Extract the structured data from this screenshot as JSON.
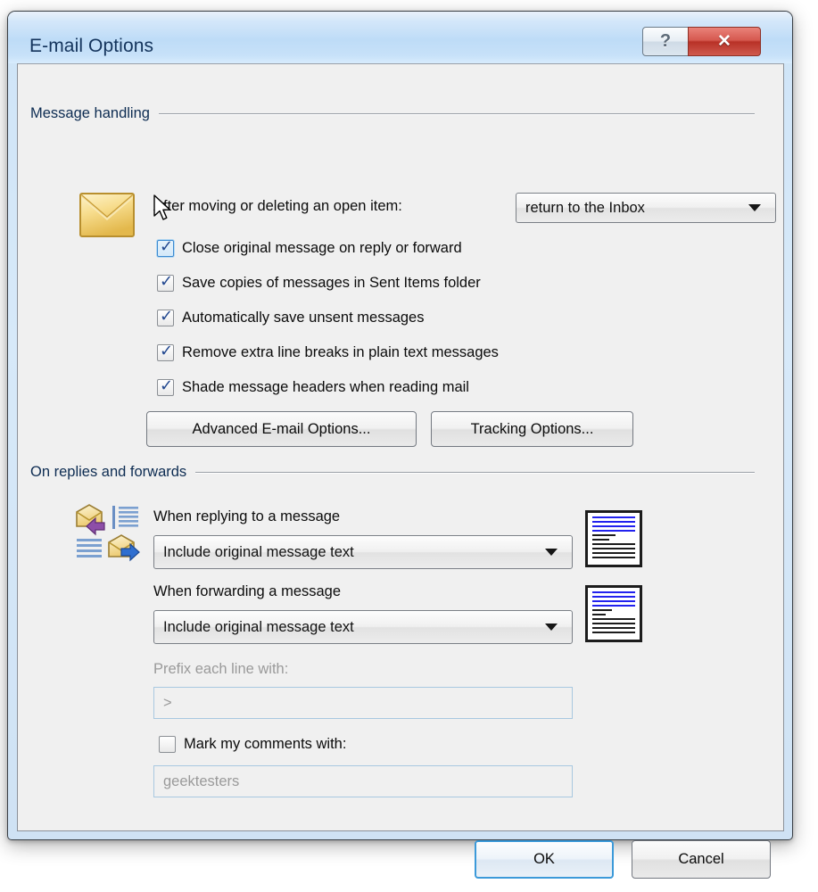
{
  "window": {
    "title": "E-mail Options",
    "help_button_glyph": "?",
    "close_button_glyph": "✕",
    "accent_color": "#3c9ad9",
    "titlebar_color": "#bedcf7",
    "close_button_color": "#b83127"
  },
  "message_handling": {
    "group_label": "Message handling",
    "after_move_label": "After moving or deleting an open item:",
    "after_move_value": "return to the Inbox",
    "checkboxes": [
      {
        "label": "Close original message on reply or forward",
        "checked": true,
        "hovered": true
      },
      {
        "label": "Save copies of messages in Sent Items folder",
        "checked": true,
        "hovered": false
      },
      {
        "label": "Automatically save unsent messages",
        "checked": true,
        "hovered": false
      },
      {
        "label": "Remove extra line breaks in plain text messages",
        "checked": true,
        "hovered": false
      },
      {
        "label": "Shade message headers when reading mail",
        "checked": true,
        "hovered": false
      }
    ],
    "advanced_button": "Advanced E-mail Options...",
    "tracking_button": "Tracking Options..."
  },
  "replies_forwards": {
    "group_label": "On replies and forwards",
    "replying_label": "When replying to a message",
    "replying_value": "Include original message text",
    "forwarding_label": "When forwarding a message",
    "forwarding_value": "Include original message text",
    "prefix_label": "Prefix each line with:",
    "prefix_value": ">",
    "prefix_disabled": true,
    "mark_comments_label": "Mark my comments with:",
    "mark_comments_checked": false,
    "mark_comments_value": "geektesters",
    "mark_comments_disabled": true,
    "preview_new_text_color": "#2222ee",
    "preview_original_text_color": "#1c1c1c"
  },
  "footer": {
    "ok_label": "OK",
    "cancel_label": "Cancel"
  }
}
